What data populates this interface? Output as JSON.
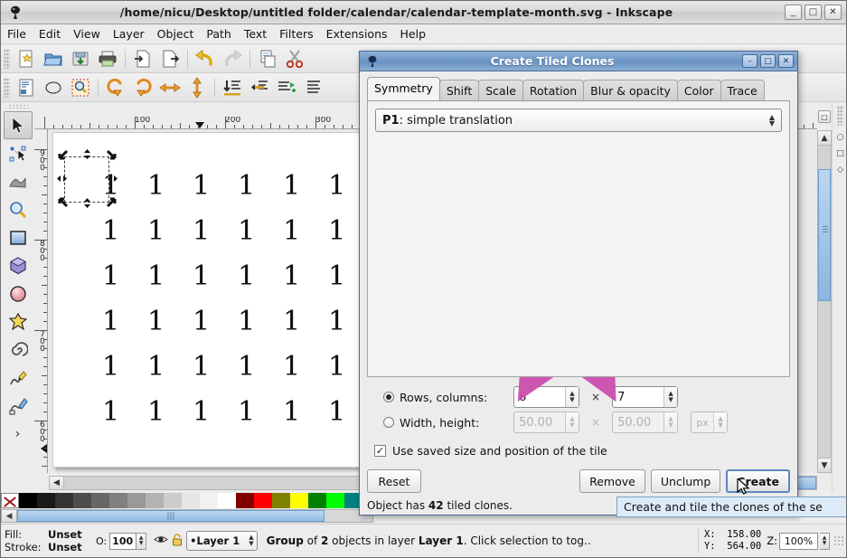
{
  "window": {
    "title": "/home/nicu/Desktop/untitled folder/calendar/calendar-template-month.svg - Inkscape",
    "minimize": "_",
    "maximize": "□",
    "close": "✕"
  },
  "menubar": {
    "items": [
      "File",
      "Edit",
      "View",
      "Layer",
      "Object",
      "Path",
      "Text",
      "Filters",
      "Extensions",
      "Help"
    ]
  },
  "toolbar_commands": [
    {
      "name": "new-document-icon"
    },
    {
      "name": "open-document-icon"
    },
    {
      "name": "save-document-icon"
    },
    {
      "name": "print-document-icon"
    },
    {
      "name": "import-icon"
    },
    {
      "name": "export-icon"
    },
    {
      "name": "undo-icon"
    },
    {
      "name": "redo-icon"
    },
    {
      "name": "copy-icon"
    },
    {
      "name": "cut-icon"
    }
  ],
  "toolbar_snap": [
    {
      "name": "document-properties-icon"
    },
    {
      "name": "fill-stroke-icon"
    },
    {
      "name": "zoom-drawing-icon"
    },
    {
      "name": "rotate-ccw-icon"
    },
    {
      "name": "rotate-cw-icon"
    },
    {
      "name": "flip-horizontal-icon"
    },
    {
      "name": "flip-vertical-icon"
    },
    {
      "name": "lower-to-bottom-icon"
    },
    {
      "name": "lower-icon"
    },
    {
      "name": "raise-icon"
    },
    {
      "name": "raise-to-top-icon"
    }
  ],
  "toolbox": [
    {
      "name": "selector-tool",
      "active": true
    },
    {
      "name": "node-tool",
      "active": false
    },
    {
      "name": "tweak-tool",
      "active": false
    },
    {
      "name": "zoom-tool",
      "active": false
    },
    {
      "name": "rectangle-tool",
      "active": false
    },
    {
      "name": "box3d-tool",
      "active": false
    },
    {
      "name": "ellipse-tool",
      "active": false
    },
    {
      "name": "star-tool",
      "active": false
    },
    {
      "name": "spiral-tool",
      "active": false
    },
    {
      "name": "pencil-tool",
      "active": false
    },
    {
      "name": "calligraphy-tool",
      "active": false
    },
    {
      "name": "more-tools",
      "active": false,
      "glyph": "›"
    }
  ],
  "rulers": {
    "horizontal_labels": [
      "100",
      "200",
      "300"
    ],
    "vertical_labels": [
      "900",
      "800",
      "700",
      "600"
    ]
  },
  "canvas": {
    "tile_digit": "1",
    "rows_visible": 6,
    "cols_visible": 6
  },
  "dialog": {
    "title": "Create Tiled Clones",
    "titlebar_buttons": {
      "minimize": "–",
      "maximize": "□",
      "close": "✕"
    },
    "tabs": [
      {
        "label": "Symmetry",
        "active": true
      },
      {
        "label": "Shift",
        "active": false
      },
      {
        "label": "Scale",
        "active": false
      },
      {
        "label": "Rotation",
        "active": false
      },
      {
        "label": "Blur & opacity",
        "active": false
      },
      {
        "label": "Color",
        "active": false
      },
      {
        "label": "Trace",
        "active": false
      }
    ],
    "symmetry_combo": {
      "code": "P1",
      "text": ": simple translation"
    },
    "rows_columns": {
      "label": "Rows, columns:",
      "selected": true,
      "rows": "6",
      "columns": "7",
      "separator": "×"
    },
    "width_height": {
      "label": "Width, height:",
      "selected": false,
      "width": "50.00",
      "height": "50.00",
      "separator": "×",
      "unit": "px"
    },
    "checkbox": {
      "label": "Use saved size and position of the tile",
      "checked": true,
      "mark": "✓"
    },
    "buttons": {
      "reset": "Reset",
      "remove": "Remove",
      "unclump": "Unclump",
      "create": "Create"
    },
    "object_info": {
      "prefix": "Object has ",
      "count": "42",
      "suffix": " tiled clones."
    }
  },
  "tooltip": {
    "text": "Create and tile the clones of the se"
  },
  "statusbar": {
    "fill_label": "Fill:",
    "fill_value": "Unset",
    "stroke_label": "Stroke:",
    "stroke_value": "Unset",
    "opacity_label": "O:",
    "opacity_value": "100",
    "layer_name": "Layer 1",
    "layer_bullet": "•",
    "message_part1": "Group",
    "message_part2": " of ",
    "message_part3": "2",
    "message_part4": " objects in layer ",
    "message_part5": "Layer 1",
    "message_part6": ". Click selection to tog..",
    "x_label": "X:",
    "x_value": "158.00",
    "y_label": "Y:",
    "y_value": "564.00",
    "zoom_label": "Z:",
    "zoom_value": "100%"
  },
  "palette": {
    "no_color_label": "X",
    "swatches": [
      "#000000",
      "#1a1a1a",
      "#333333",
      "#4d4d4d",
      "#666666",
      "#808080",
      "#999999",
      "#b3b3b3",
      "#cccccc",
      "#e6e6e6",
      "#f2f2f2",
      "#ffffff",
      "#800000",
      "#ff0000",
      "#808000",
      "#ffff00",
      "#008000",
      "#00ff00",
      "#008080",
      "#00ffff",
      "#000080",
      "#0000ff"
    ]
  },
  "annotations": {
    "arrow_color": "#cc4fae",
    "arrows": [
      {
        "name": "arrow-to-rows-field"
      },
      {
        "name": "arrow-to-columns-field"
      }
    ]
  }
}
